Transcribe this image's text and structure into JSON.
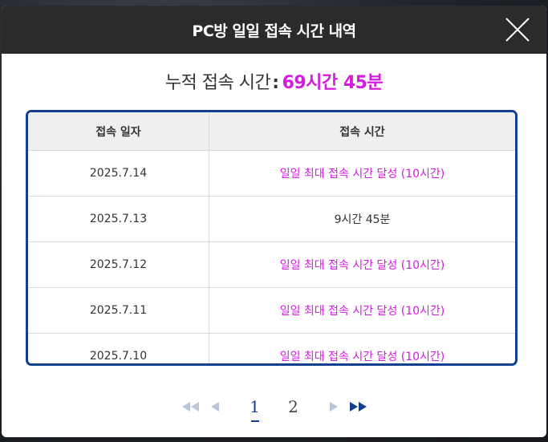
{
  "modal": {
    "title": "PC방 일일 접속 시간 내역",
    "close_icon": "close-icon"
  },
  "summary": {
    "label": "누적 접속 시간",
    "separator": ":",
    "total": "69시간 45분",
    "accent_color": "#d41be0"
  },
  "table": {
    "headers": [
      "접속 일자",
      "접속 시간"
    ],
    "rows": [
      {
        "date": "2025.7.14",
        "time": "일일 최대 접속 시간 달성 (10시간)",
        "max": true
      },
      {
        "date": "2025.7.13",
        "time": "9시간 45분",
        "max": false
      },
      {
        "date": "2025.7.12",
        "time": "일일 최대 접속 시간 달성 (10시간)",
        "max": true
      },
      {
        "date": "2025.7.11",
        "time": "일일 최대 접속 시간 달성 (10시간)",
        "max": true
      },
      {
        "date": "2025.7.10",
        "time": "일일 최대 접속 시간 달성 (10시간)",
        "max": true
      }
    ],
    "border_color": "#123f8f"
  },
  "pagination": {
    "first_icon": "double-left-arrow-icon",
    "prev_icon": "left-arrow-icon",
    "pages": [
      "1",
      "2"
    ],
    "current": "1",
    "next_icon": "right-arrow-icon",
    "last_icon": "double-right-arrow-icon"
  }
}
